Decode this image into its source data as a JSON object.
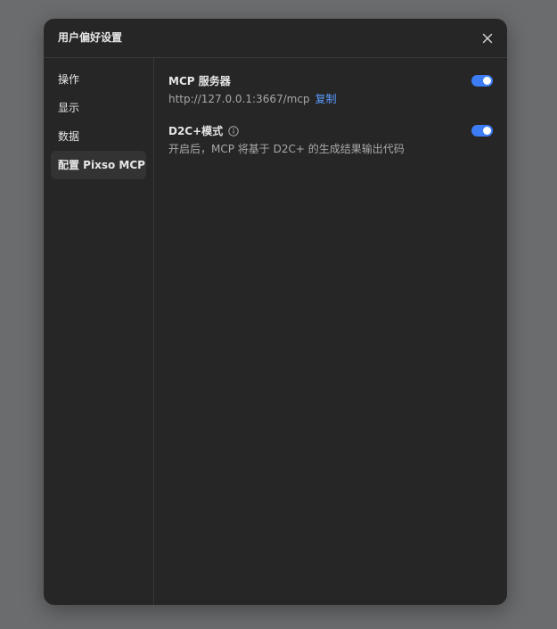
{
  "dialog": {
    "title": "用户偏好设置",
    "close_icon": "close-icon"
  },
  "sidebar": {
    "items": [
      {
        "label": "操作",
        "active": false
      },
      {
        "label": "显示",
        "active": false
      },
      {
        "label": "数据",
        "active": false
      },
      {
        "label": "配置 Pixso MCP",
        "active": true
      }
    ]
  },
  "content": {
    "mcp_server": {
      "title": "MCP 服务器",
      "url": "http://127.0.0.1:3667/mcp",
      "copy_label": "复制",
      "enabled": true
    },
    "d2c_mode": {
      "title": "D2C+模式",
      "info_icon": "info-icon",
      "description": "开启后，MCP 将基于 D2C+ 的生成结果输出代码",
      "enabled": true
    }
  },
  "colors": {
    "backdrop": "#6b6c6e",
    "panel": "#262626",
    "accent": "#3c7cf5",
    "link": "#5b9bff"
  }
}
